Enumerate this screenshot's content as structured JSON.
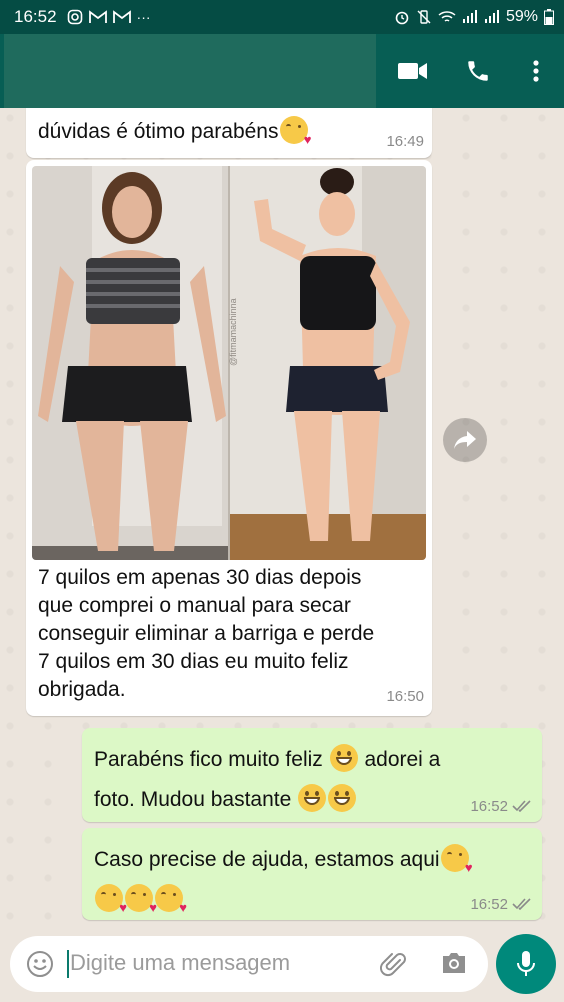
{
  "status_bar": {
    "time": "16:52",
    "battery": "59%"
  },
  "messages": [
    {
      "text": "dúvidas é ótimo parabéns",
      "time": "16:49"
    },
    {
      "caption": "7 quilos em apenas 30 dias depois que comprei o manual para secar conseguir eliminar a barriga e perde 7 quilos em 30 dias eu muito feliz obrigada.",
      "caption_lines": [
        "7 quilos em apenas 30 dias depois",
        "que comprei o manual para secar",
        "conseguir eliminar a barriga e perde",
        "7 quilos em 30 dias eu muito feliz",
        "obrigada."
      ],
      "time": "16:50",
      "watermark": "@fitmamachinna"
    },
    {
      "text_a": "Parabéns fico muito feliz",
      "text_b": "adorei a",
      "text_c": "foto. Mudou bastante",
      "time": "16:52"
    },
    {
      "text": "Caso precise de ajuda, estamos aqui",
      "time": "16:52"
    }
  ],
  "composer": {
    "placeholder": "Digite uma mensagem"
  },
  "colors": {
    "header": "#075e54",
    "status_bar": "#054c44",
    "outgoing": "#dcf8c6",
    "incoming": "#ffffff",
    "mic": "#00897b"
  },
  "icons": [
    "video-call-icon",
    "phone-icon",
    "more-icon",
    "forward-icon",
    "emoji-icon",
    "attach-icon",
    "camera-icon",
    "mic-icon"
  ]
}
